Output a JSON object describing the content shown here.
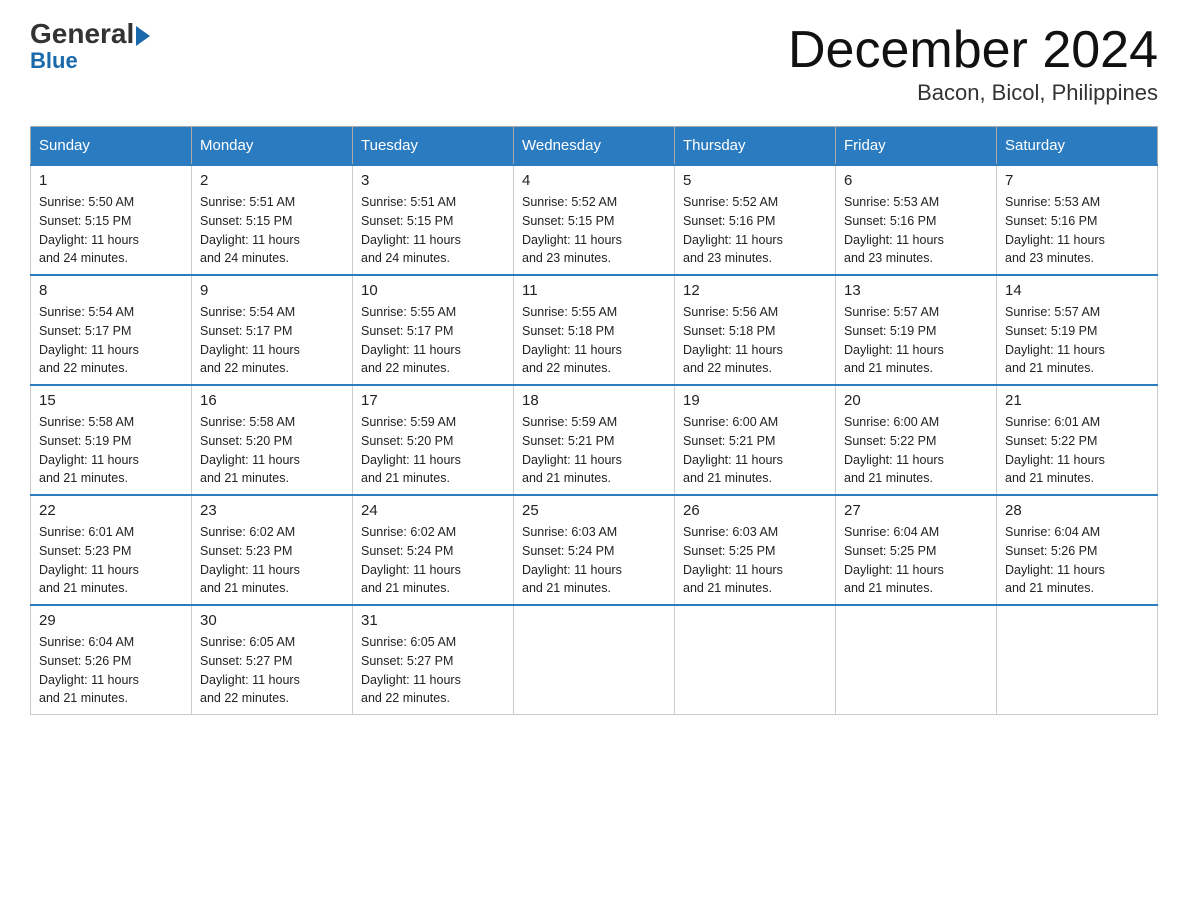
{
  "header": {
    "logo_top": "General",
    "logo_bottom": "Blue",
    "title": "December 2024",
    "subtitle": "Bacon, Bicol, Philippines"
  },
  "days_of_week": [
    "Sunday",
    "Monday",
    "Tuesday",
    "Wednesday",
    "Thursday",
    "Friday",
    "Saturday"
  ],
  "weeks": [
    [
      {
        "day": "1",
        "sunrise": "5:50 AM",
        "sunset": "5:15 PM",
        "daylight": "11 hours and 24 minutes."
      },
      {
        "day": "2",
        "sunrise": "5:51 AM",
        "sunset": "5:15 PM",
        "daylight": "11 hours and 24 minutes."
      },
      {
        "day": "3",
        "sunrise": "5:51 AM",
        "sunset": "5:15 PM",
        "daylight": "11 hours and 24 minutes."
      },
      {
        "day": "4",
        "sunrise": "5:52 AM",
        "sunset": "5:15 PM",
        "daylight": "11 hours and 23 minutes."
      },
      {
        "day": "5",
        "sunrise": "5:52 AM",
        "sunset": "5:16 PM",
        "daylight": "11 hours and 23 minutes."
      },
      {
        "day": "6",
        "sunrise": "5:53 AM",
        "sunset": "5:16 PM",
        "daylight": "11 hours and 23 minutes."
      },
      {
        "day": "7",
        "sunrise": "5:53 AM",
        "sunset": "5:16 PM",
        "daylight": "11 hours and 23 minutes."
      }
    ],
    [
      {
        "day": "8",
        "sunrise": "5:54 AM",
        "sunset": "5:17 PM",
        "daylight": "11 hours and 22 minutes."
      },
      {
        "day": "9",
        "sunrise": "5:54 AM",
        "sunset": "5:17 PM",
        "daylight": "11 hours and 22 minutes."
      },
      {
        "day": "10",
        "sunrise": "5:55 AM",
        "sunset": "5:17 PM",
        "daylight": "11 hours and 22 minutes."
      },
      {
        "day": "11",
        "sunrise": "5:55 AM",
        "sunset": "5:18 PM",
        "daylight": "11 hours and 22 minutes."
      },
      {
        "day": "12",
        "sunrise": "5:56 AM",
        "sunset": "5:18 PM",
        "daylight": "11 hours and 22 minutes."
      },
      {
        "day": "13",
        "sunrise": "5:57 AM",
        "sunset": "5:19 PM",
        "daylight": "11 hours and 21 minutes."
      },
      {
        "day": "14",
        "sunrise": "5:57 AM",
        "sunset": "5:19 PM",
        "daylight": "11 hours and 21 minutes."
      }
    ],
    [
      {
        "day": "15",
        "sunrise": "5:58 AM",
        "sunset": "5:19 PM",
        "daylight": "11 hours and 21 minutes."
      },
      {
        "day": "16",
        "sunrise": "5:58 AM",
        "sunset": "5:20 PM",
        "daylight": "11 hours and 21 minutes."
      },
      {
        "day": "17",
        "sunrise": "5:59 AM",
        "sunset": "5:20 PM",
        "daylight": "11 hours and 21 minutes."
      },
      {
        "day": "18",
        "sunrise": "5:59 AM",
        "sunset": "5:21 PM",
        "daylight": "11 hours and 21 minutes."
      },
      {
        "day": "19",
        "sunrise": "6:00 AM",
        "sunset": "5:21 PM",
        "daylight": "11 hours and 21 minutes."
      },
      {
        "day": "20",
        "sunrise": "6:00 AM",
        "sunset": "5:22 PM",
        "daylight": "11 hours and 21 minutes."
      },
      {
        "day": "21",
        "sunrise": "6:01 AM",
        "sunset": "5:22 PM",
        "daylight": "11 hours and 21 minutes."
      }
    ],
    [
      {
        "day": "22",
        "sunrise": "6:01 AM",
        "sunset": "5:23 PM",
        "daylight": "11 hours and 21 minutes."
      },
      {
        "day": "23",
        "sunrise": "6:02 AM",
        "sunset": "5:23 PM",
        "daylight": "11 hours and 21 minutes."
      },
      {
        "day": "24",
        "sunrise": "6:02 AM",
        "sunset": "5:24 PM",
        "daylight": "11 hours and 21 minutes."
      },
      {
        "day": "25",
        "sunrise": "6:03 AM",
        "sunset": "5:24 PM",
        "daylight": "11 hours and 21 minutes."
      },
      {
        "day": "26",
        "sunrise": "6:03 AM",
        "sunset": "5:25 PM",
        "daylight": "11 hours and 21 minutes."
      },
      {
        "day": "27",
        "sunrise": "6:04 AM",
        "sunset": "5:25 PM",
        "daylight": "11 hours and 21 minutes."
      },
      {
        "day": "28",
        "sunrise": "6:04 AM",
        "sunset": "5:26 PM",
        "daylight": "11 hours and 21 minutes."
      }
    ],
    [
      {
        "day": "29",
        "sunrise": "6:04 AM",
        "sunset": "5:26 PM",
        "daylight": "11 hours and 21 minutes."
      },
      {
        "day": "30",
        "sunrise": "6:05 AM",
        "sunset": "5:27 PM",
        "daylight": "11 hours and 22 minutes."
      },
      {
        "day": "31",
        "sunrise": "6:05 AM",
        "sunset": "5:27 PM",
        "daylight": "11 hours and 22 minutes."
      },
      null,
      null,
      null,
      null
    ]
  ],
  "labels": {
    "sunrise": "Sunrise:",
    "sunset": "Sunset:",
    "daylight": "Daylight:"
  }
}
